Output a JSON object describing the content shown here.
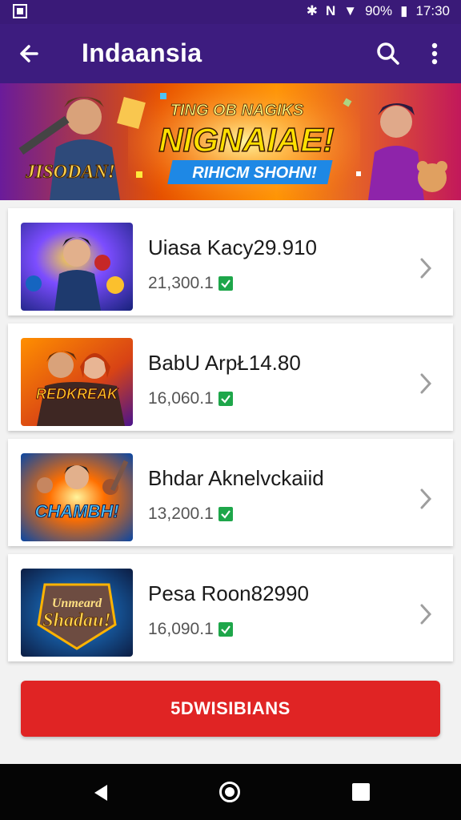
{
  "status_bar": {
    "battery": "90%",
    "time": "17:30"
  },
  "app_bar": {
    "title": "Indaansia"
  },
  "banner": {
    "headline_small": "TING OB NAGIKS",
    "headline_big": "NIGNAIAE!",
    "subline": "RIHICM SHOHN!",
    "badge": "JISODAN!"
  },
  "items": [
    {
      "title": "Uiasa Kacy29.910",
      "meta": "21,300.1",
      "thumb_text": ""
    },
    {
      "title": "BabU ArpŁ14.80",
      "meta": "16,060.1",
      "thumb_text": "REDKREAK"
    },
    {
      "title": "Bhdar Aknelvckaiid",
      "meta": "13,200.1",
      "thumb_text": "CHAMBH!"
    },
    {
      "title": "Pesa Roon82990",
      "meta": "16,090.1",
      "thumb_text": "Shadau!"
    }
  ],
  "cta": {
    "label": "5DWISIBIANS"
  },
  "colors": {
    "app_bar": "#3d1c7f",
    "cta": "#e02424",
    "check": "#1ea64a"
  }
}
